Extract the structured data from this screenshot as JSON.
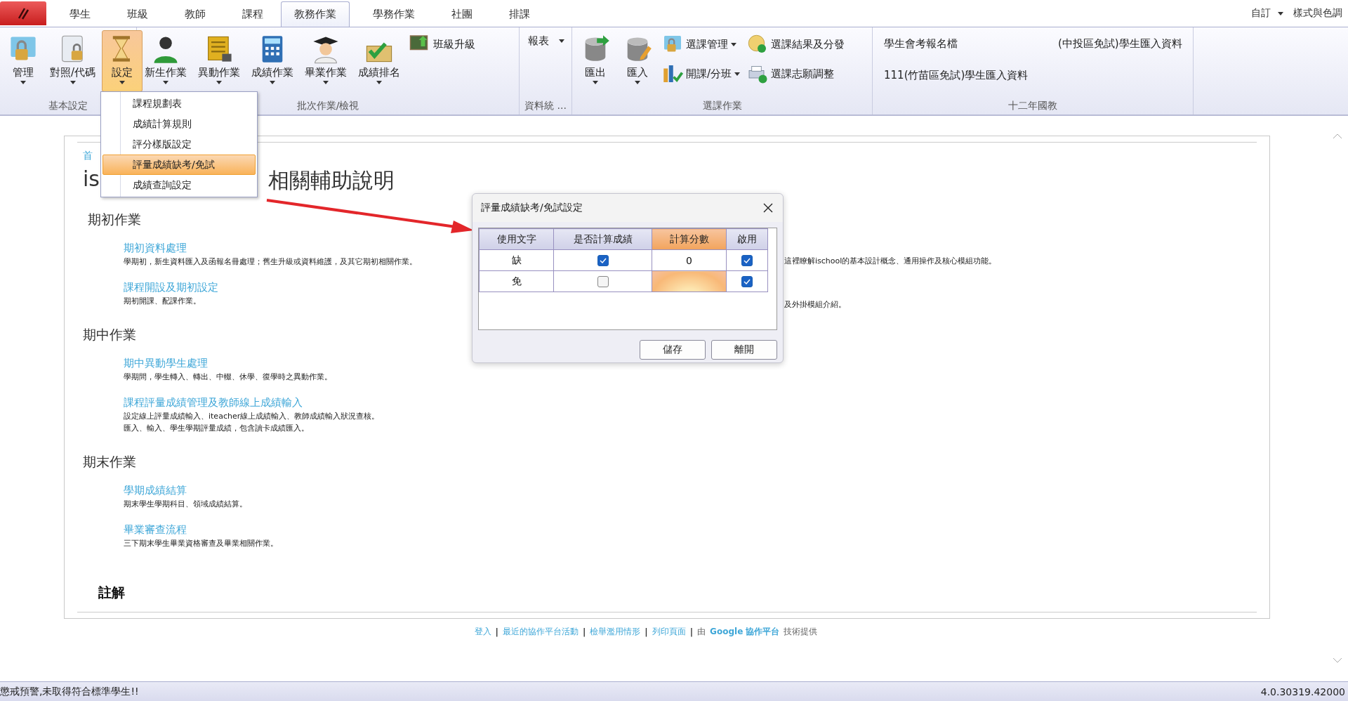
{
  "ribbon": {
    "tabs": [
      {
        "label": "學生",
        "selected": false
      },
      {
        "label": "班級",
        "selected": false
      },
      {
        "label": "教師",
        "selected": false
      },
      {
        "label": "課程",
        "selected": false
      },
      {
        "label": "教務作業",
        "selected": true
      },
      {
        "label": "學務作業",
        "selected": false
      },
      {
        "label": "社團",
        "selected": false
      },
      {
        "label": "排課",
        "selected": false
      }
    ],
    "quick": [
      {
        "label": "自訂",
        "dropdown": true
      },
      {
        "label": "樣式與色調"
      }
    ],
    "groups": [
      {
        "label": "基本設定",
        "items": [
          {
            "kind": "large",
            "label": "管理",
            "dropdown": true
          },
          {
            "kind": "large",
            "label": "對照/代碼",
            "dropdown": true
          },
          {
            "kind": "large",
            "label": "設定",
            "dropdown": true,
            "open": true
          }
        ]
      },
      {
        "label": "批次作業/檢視",
        "items": [
          {
            "kind": "large",
            "label": "新生作業",
            "dropdown": true
          },
          {
            "kind": "large",
            "label": "異動作業",
            "dropdown": true
          },
          {
            "kind": "large",
            "label": "成績作業",
            "dropdown": true
          },
          {
            "kind": "large",
            "label": "畢業作業",
            "dropdown": true
          },
          {
            "kind": "large",
            "label": "成績排名",
            "dropdown": true
          },
          {
            "kind": "small",
            "label": "班級升級"
          }
        ]
      },
      {
        "label": "資料統 ...",
        "items": [
          {
            "kind": "text",
            "label": "報表",
            "dropdown": true
          }
        ]
      },
      {
        "label": "選課作業",
        "items": [
          {
            "kind": "large",
            "label": "匯出",
            "dropdown": true
          },
          {
            "kind": "large",
            "label": "匯入",
            "dropdown": true
          },
          {
            "kind": "small",
            "label": "選課管理",
            "dropdown": true
          },
          {
            "kind": "small",
            "label": "開課/分班",
            "dropdown": true
          },
          {
            "kind": "small",
            "label": "選課結果及分發"
          },
          {
            "kind": "small",
            "label": "選課志願調整"
          }
        ]
      },
      {
        "label": "十二年國教",
        "items": [
          {
            "kind": "text",
            "label": "學生會考報名檔"
          },
          {
            "kind": "text",
            "label": "(中投區免試)學生匯入資料"
          },
          {
            "kind": "text",
            "label": "111(竹苗區免試)學生匯入資料"
          }
        ]
      }
    ]
  },
  "menu": [
    {
      "label": "課程規劃表",
      "selected": false
    },
    {
      "label": "成績計算規則",
      "selected": false
    },
    {
      "label": "評分樣版設定",
      "selected": false
    },
    {
      "label": "評量成績缺考/免試",
      "selected": true
    },
    {
      "label": "成績查詢設定",
      "selected": false
    }
  ],
  "page": {
    "breadcrumb": "首",
    "title_start": "is",
    "title_end": "相關輔助說明",
    "sections": [
      {
        "heading": "期初作業",
        "items": [
          {
            "link": "期初資料處理",
            "lines": [
              "學期初，新生資料匯入及函報名冊處理；舊生升級或資料維護，及其它期初相關作業。"
            ]
          },
          {
            "link": "課程開設及期初設定",
            "lines": [
              "期初開課、配課作業。"
            ]
          }
        ]
      },
      {
        "heading": "期中作業",
        "items": [
          {
            "link": "期中異動學生處理",
            "lines": [
              "學期間，學生轉入、轉出、中輟、休學、復學時之異動作業。"
            ]
          },
          {
            "link": "課程評量成績管理及教師線上成績輸入",
            "lines": [
              "設定線上評量成績輸入、iteacher線上成績輸入、教師成績輸入狀況查核。",
              "匯入、輸入、學生學期評量成績，包含讀卡成績匯入。"
            ]
          }
        ]
      },
      {
        "heading": "期末作業",
        "items": [
          {
            "link": "學期成績結算",
            "lines": [
              "期末學生學期科目、領域成績結算。"
            ]
          },
          {
            "link": "畢業審查流程",
            "lines": [
              "三下期末學生畢業資格審查及畢業相關作業。"
            ]
          }
        ]
      }
    ],
    "note": "註解",
    "fragments": [
      "這裡瞭解ischool的基本設計概念、通用操作及核心模組功能。",
      "及外掛模組介紹。"
    ],
    "footer": [
      {
        "kind": "link",
        "text": "登入"
      },
      {
        "kind": "sep",
        "text": "|"
      },
      {
        "kind": "link",
        "text": "最近的協作平台活動"
      },
      {
        "kind": "sep",
        "text": "|"
      },
      {
        "kind": "link",
        "text": "檢舉濫用情形"
      },
      {
        "kind": "sep",
        "text": "|"
      },
      {
        "kind": "link",
        "text": "列印頁面"
      },
      {
        "kind": "sep",
        "text": "|"
      },
      {
        "kind": "text",
        "text": "由"
      },
      {
        "kind": "strong",
        "text": "Google 協作平台"
      },
      {
        "kind": "text",
        "text": "技術提供"
      }
    ]
  },
  "dialog": {
    "title": "評量成績缺考/免試設定",
    "columns": [
      {
        "label": "使用文字",
        "selected": false
      },
      {
        "label": "是否計算成績",
        "selected": false
      },
      {
        "label": "計算分數",
        "selected": true
      },
      {
        "label": "啟用",
        "selected": false
      }
    ],
    "rows": [
      {
        "text": "缺",
        "counts": true,
        "score": "0",
        "score_selected": false,
        "enabled": true
      },
      {
        "text": "免",
        "counts": false,
        "score_selected": true,
        "enabled": true
      }
    ],
    "buttons": [
      "儲存",
      "離開"
    ]
  },
  "status_bar": {
    "message": "懲戒預警,未取得符合標準學生!!",
    "version": "4.0.30319.42000"
  }
}
